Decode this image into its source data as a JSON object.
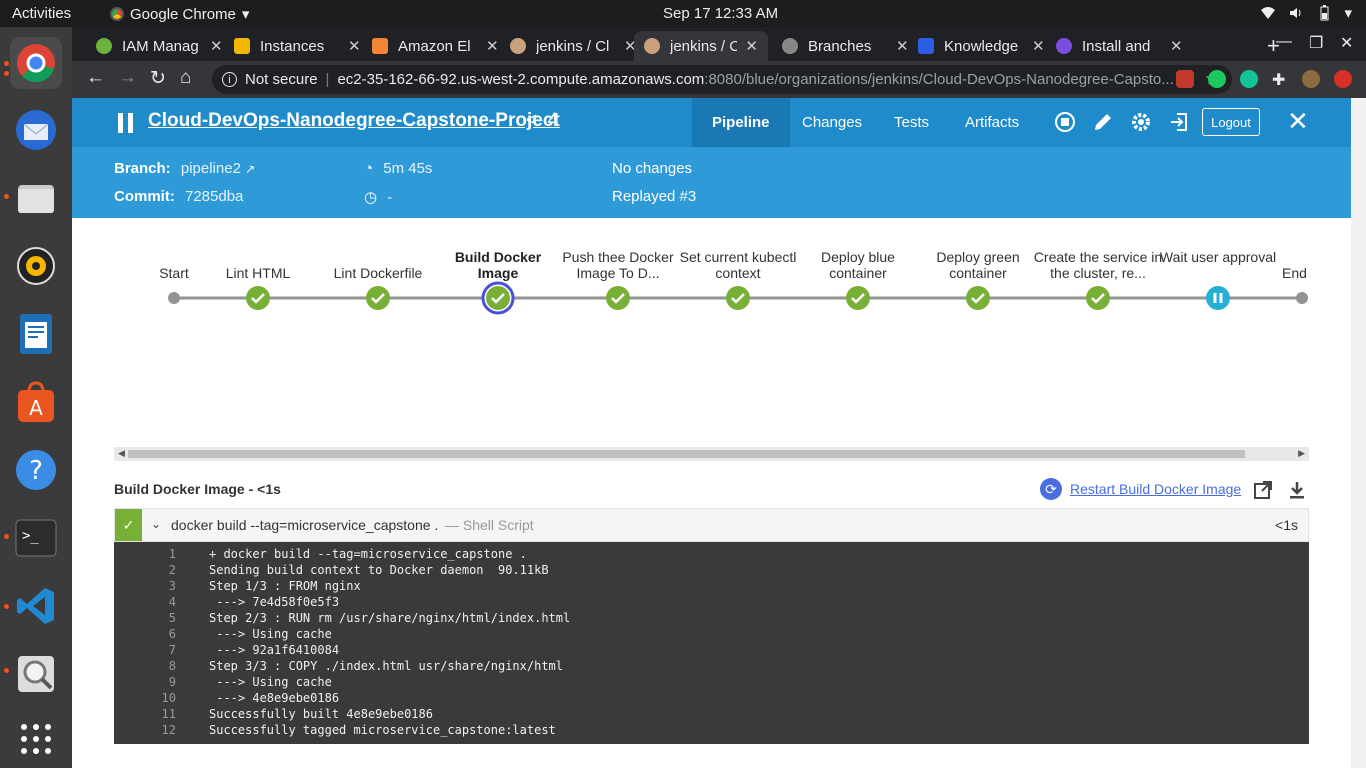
{
  "system": {
    "activities": "Activities",
    "app_name": "Google Chrome",
    "clock": "Sep 17  12:33 AM"
  },
  "browser": {
    "tabs": [
      {
        "title": "IAM Manag",
        "color": "#6cb33f"
      },
      {
        "title": "Instances",
        "color": "#f2b705"
      },
      {
        "title": "Amazon El",
        "color": "#f58536"
      },
      {
        "title": "jenkins / Cl",
        "color": "#c9a27d"
      },
      {
        "title": "jenkins / Cl",
        "color": "#c9a27d"
      },
      {
        "title": "Branches",
        "color": "#888888"
      },
      {
        "title": "Knowledge",
        "color": "#2c5fe6"
      },
      {
        "title": "Install and",
        "color": "#7b4ee0"
      }
    ],
    "url_secure": "Not secure",
    "url_host": "ec2-35-162-66-92.us-west-2.compute.amazonaws.com",
    "url_path": ":8080/blue/organizations/jenkins/Cloud-DevOps-Nanodegree-Capsto..."
  },
  "jenkins": {
    "project": "Cloud-DevOps-Nanodegree-Capstone-Project",
    "run_separator": "<",
    "run_number": "4",
    "nav": [
      "Pipeline",
      "Changes",
      "Tests",
      "Artifacts"
    ],
    "logout": "Logout",
    "branch_label": "Branch:",
    "branch_value": "pipeline2",
    "commit_label": "Commit:",
    "commit_value": "7285dba",
    "duration": "5m 45s",
    "ended": "-",
    "changes": "No changes",
    "replayed": "Replayed #3"
  },
  "pipeline": {
    "stages": [
      {
        "label": "Start",
        "status": "start"
      },
      {
        "label": "Lint HTML",
        "status": "success"
      },
      {
        "label": "Lint Dockerfile",
        "status": "success"
      },
      {
        "label": "Build Docker Image",
        "status": "selected"
      },
      {
        "label": "Push thee Docker Image To D...",
        "status": "success"
      },
      {
        "label": "Set current kubectl context",
        "status": "success"
      },
      {
        "label": "Deploy blue container",
        "status": "success"
      },
      {
        "label": "Deploy green container",
        "status": "success"
      },
      {
        "label": "Create the service in the cluster, re...",
        "status": "success"
      },
      {
        "label": "Wait user approval",
        "status": "paused"
      },
      {
        "label": "End",
        "status": "end"
      }
    ]
  },
  "step": {
    "title": "Build Docker Image - <1s",
    "restart_label": "Restart Build Docker Image",
    "command": "docker build --tag=microservice_capstone .",
    "type": "— Shell Script",
    "duration": "<1s",
    "log": [
      "+ docker build --tag=microservice_capstone .",
      "Sending build context to Docker daemon  90.11kB",
      "Step 1/3 : FROM nginx",
      " ---> 7e4d58f0e5f3",
      "Step 2/3 : RUN rm /usr/share/nginx/html/index.html",
      " ---> Using cache",
      " ---> 92a1f6410084",
      "Step 3/3 : COPY ./index.html usr/share/nginx/html",
      " ---> Using cache",
      " ---> 4e8e9ebe0186",
      "Successfully built 4e8e9ebe0186",
      "Successfully tagged microservice_capstone:latest"
    ]
  },
  "colors": {
    "success": "#78b037",
    "paused": "#24b0d5",
    "selected_ring": "#4a4fd8",
    "header": "#2e9ad8"
  }
}
